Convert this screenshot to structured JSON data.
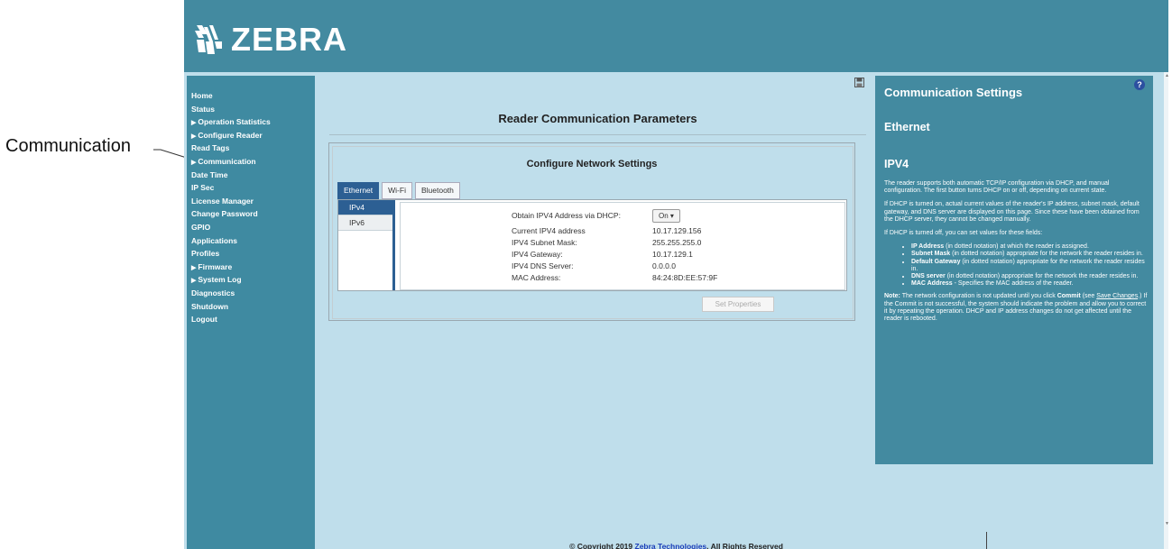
{
  "callout": {
    "label": "Communication"
  },
  "brand": {
    "name": "ZEBRA"
  },
  "sidebar": {
    "items": [
      {
        "label": "Home",
        "arrow": ""
      },
      {
        "label": "Status",
        "arrow": ""
      },
      {
        "label": "Operation Statistics",
        "arrow": "▶"
      },
      {
        "label": "Configure Reader",
        "arrow": "▶"
      },
      {
        "label": "Read Tags",
        "arrow": ""
      },
      {
        "label": "Communication",
        "arrow": "▶"
      },
      {
        "label": "Date Time",
        "arrow": ""
      },
      {
        "label": "IP Sec",
        "arrow": ""
      },
      {
        "label": "License Manager",
        "arrow": ""
      },
      {
        "label": "Change Password",
        "arrow": ""
      },
      {
        "label": "GPIO",
        "arrow": ""
      },
      {
        "label": "Applications",
        "arrow": ""
      },
      {
        "label": "Profiles",
        "arrow": ""
      },
      {
        "label": "Firmware",
        "arrow": "▶"
      },
      {
        "label": "System Log",
        "arrow": "▶"
      },
      {
        "label": "Diagnostics",
        "arrow": ""
      },
      {
        "label": "Shutdown",
        "arrow": ""
      },
      {
        "label": "Logout",
        "arrow": ""
      }
    ]
  },
  "main": {
    "title": "Reader Communication Parameters",
    "panel_title": "Configure Network Settings",
    "tabs": [
      "Ethernet",
      "Wi-Fi",
      "Bluetooth"
    ],
    "active_tab": "Ethernet",
    "vtabs": [
      "IPv4",
      "IPv6"
    ],
    "active_vtab": "IPv4",
    "fields": {
      "dhcp_label": "Obtain IPV4 Address via DHCP:",
      "dhcp_value": "On ▾",
      "ipv4_label": "Current IPV4 address",
      "ipv4_value": "10.17.129.156",
      "mask_label": "IPV4 Subnet Mask:",
      "mask_value": "255.255.255.0",
      "gw_label": "IPV4 Gateway:",
      "gw_value": "10.17.129.1",
      "dns_label": "IPV4 DNS Server:",
      "dns_value": "0.0.0.0",
      "mac_label": "MAC Address:",
      "mac_value": "84:24:8D:EE:57:9F"
    },
    "set_button": "Set Properties"
  },
  "help": {
    "title": "Communication Settings",
    "subtitle": "Ethernet",
    "section": "IPV4",
    "p1": "The reader supports both automatic TCP/IP configuration via DHCP, and manual configuration. The first button turns DHCP on or off, depending on current state.",
    "p2": "If DHCP is turned on, actual current values of the reader's IP address, subnet mask, default gateway, and DNS server are displayed on this page. Since these have been obtained from the DHCP server, they cannot be changed manually.",
    "p3": "If DHCP is turned off, you can set values for these fields:",
    "bullets": [
      {
        "b": "IP Address",
        "t": " (in dotted notation) at which the reader is assigned."
      },
      {
        "b": "Subnet Mask",
        "t": " (in dotted notation) appropriate for the network the reader resides in."
      },
      {
        "b": "Default Gateway",
        "t": " (in dotted notation) appropriate for the network the reader resides in."
      },
      {
        "b": "DNS server",
        "t": " (in dotted notation) appropriate for the network the reader resides in."
      },
      {
        "b": "MAC Address",
        "t": " - Specifies the MAC address of the reader."
      }
    ],
    "note_label": "Note:",
    "note_a": " The network configuration is not updated until you click ",
    "note_commit": "Commit",
    "note_b": " (see ",
    "note_link": "Save Changes",
    "note_c": ".) If the Commit is not successful, the system should indicate the problem and allow you to correct it by repeating the operation. DHCP and IP address changes do not get affected until the reader is rebooted."
  },
  "footer": {
    "prefix": "© Copyright 2019 ",
    "link": "Zebra Technologies",
    "suffix": ". All Rights Reserved"
  }
}
